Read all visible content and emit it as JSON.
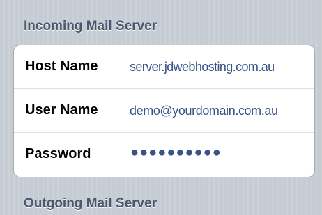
{
  "incoming_section": {
    "title": "Incoming Mail Server",
    "rows": [
      {
        "label": "Host Name",
        "value": "server.jdwebhosting.com.au"
      },
      {
        "label": "User Name",
        "value": "demo@yourdomain.com.au"
      },
      {
        "label": "Password",
        "value": "●●●●●●●●●●"
      }
    ]
  },
  "outgoing_section": {
    "title": "Outgoing Mail Server"
  },
  "colors": {
    "section_header": "#4c566c",
    "value_text": "#385487",
    "label_text": "#000000",
    "background": "#c5ccd4"
  }
}
